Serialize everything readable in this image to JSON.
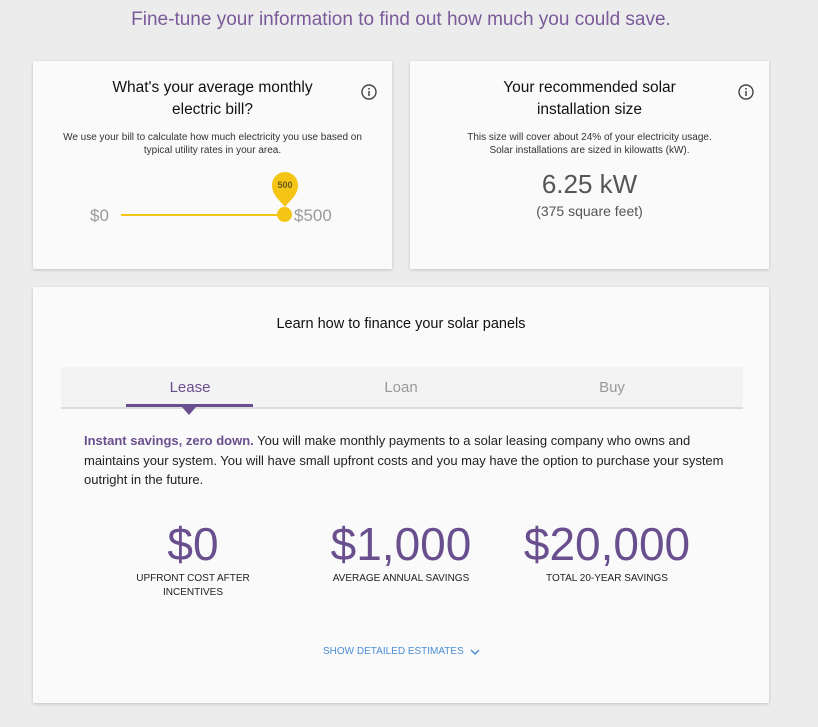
{
  "headline": "Fine-tune your information to find out how much you could save.",
  "bill_card": {
    "title": "What's your average monthly electric bill?",
    "description": "We use your bill to calculate how much electricity you use based on typical utility rates in your area.",
    "slider_min_label": "$0",
    "slider_max_label": "$500",
    "slider_value_label": "500",
    "slider_fraction": 1.0
  },
  "size_card": {
    "title": "Your recommended solar installation size",
    "description_line1": "This size will cover about 24% of your electricity usage.",
    "description_line2": "Solar installations are sized in kilowatts (kW).",
    "size_value": "6.25 kW",
    "size_area": "(375 square feet)"
  },
  "finance_card": {
    "title": "Learn how to finance your solar panels",
    "tabs": [
      {
        "label": "Lease",
        "active": true
      },
      {
        "label": "Loan",
        "active": false
      },
      {
        "label": "Buy",
        "active": false
      }
    ],
    "description_lead": "Instant savings, zero down.",
    "description_body": " You will make monthly payments to a solar leasing company who owns and maintains your system. You will have small upfront costs and you may have the option to purchase your system outright in the future.",
    "stats": [
      {
        "value": "$0",
        "label_line1": "UPFRONT COST AFTER",
        "label_line2": "INCENTIVES"
      },
      {
        "value": "$1,000",
        "label_line1": "AVERAGE ANNUAL SAVINGS",
        "label_line2": ""
      },
      {
        "value": "$20,000",
        "label_line1": "TOTAL 20-YEAR SAVINGS",
        "label_line2": ""
      }
    ],
    "show_more_label": "SHOW DETAILED ESTIMATES"
  },
  "colors": {
    "accent_purple": "#6a4f8e",
    "slider_yellow": "#f5c516",
    "link_blue": "#4a8ed6"
  }
}
